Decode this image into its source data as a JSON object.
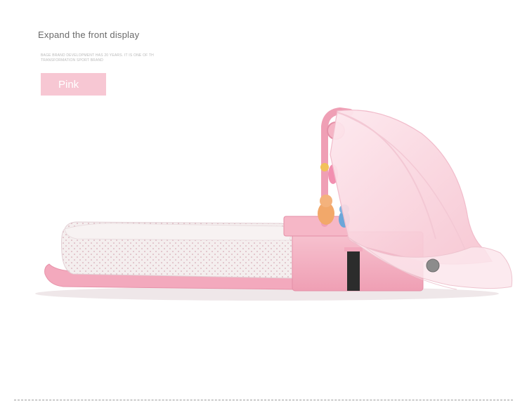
{
  "heading": "Expand the front display",
  "fineprint": "BAGE BRAND DEVELOPMENT HAS 20 YEARS. IT IS ONE OF TH TRANSFORMATION SPORT BRAND",
  "color_badge": {
    "label": "Pink",
    "background": "#f7c7d3"
  },
  "product_photo": {
    "subject": "pink portable baby crib with mosquito net canopy and hanging toys",
    "colors": {
      "body": "#f4b6c6",
      "mattress": "#f3eded",
      "net": "#fbe0e8"
    }
  }
}
